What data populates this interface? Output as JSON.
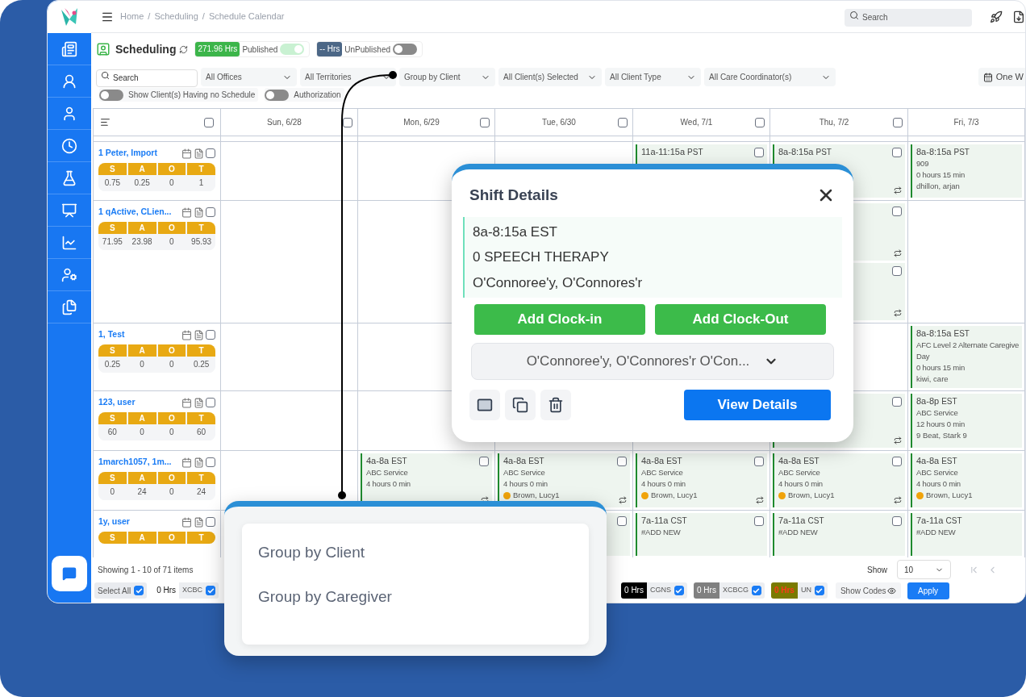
{
  "header": {
    "breadcrumbs": [
      "Home",
      "Scheduling",
      "Schedule Calendar"
    ],
    "separator": "/",
    "search": {
      "placeholder": "Search"
    }
  },
  "toolbar": {
    "title": "Scheduling",
    "published": {
      "hours": "271.96 Hrs",
      "label": "Published",
      "on": true
    },
    "unpublished": {
      "hours": "-- Hrs",
      "label": "UnPublished",
      "on": false
    }
  },
  "filters": {
    "search": {
      "placeholder": "Search"
    },
    "selects": [
      "All Offices",
      "All Territories",
      "Group by Client",
      "All Client(s) Selected",
      "All Client Type",
      "All Care Coordinator(s)"
    ],
    "range": "One W"
  },
  "toggles": [
    {
      "label": "Show Client(s) Having no Schedule",
      "on": false
    },
    {
      "label": "Authorization",
      "on": false
    }
  ],
  "grid": {
    "select_all_checked": false,
    "days": [
      {
        "label": "Sun, 6/28",
        "kind": "checkbox",
        "checked": false
      },
      {
        "label": "Mon, 6/29",
        "kind": "checkbox",
        "checked": false
      },
      {
        "label": "Tue, 6/30",
        "kind": "checkbox",
        "checked": false
      },
      {
        "label": "Wed, 7/1",
        "kind": "checkbox",
        "checked": false
      },
      {
        "label": "Thu, 7/2",
        "kind": "checkbox",
        "checked": false
      },
      {
        "label": "Fri, 7/3",
        "kind": "plain"
      }
    ]
  },
  "clients": [
    {
      "name": "1 Peter, Import",
      "checked": false,
      "stats": [
        {
          "label": "S",
          "value": "0.75"
        },
        {
          "label": "A",
          "value": "0.25"
        },
        {
          "label": "O",
          "value": "0"
        },
        {
          "label": "T",
          "value": "1"
        }
      ],
      "cells": [
        {},
        {},
        {},
        {
          "shifts": [
            {
              "time": "11a-11:15a",
              "zone": "PST",
              "checked": false
            }
          ]
        },
        {
          "shifts": [
            {
              "time": "8a-8:15a",
              "zone": "PST",
              "checked": false,
              "swap": true
            }
          ]
        },
        {
          "shifts": [
            {
              "time": "8a-8:15a",
              "zone": "PST",
              "lines": [
                "909",
                "0 hours 15 min"
              ],
              "caregiver": {
                "name": "dhillon, arjan",
                "warning": false
              }
            }
          ]
        }
      ]
    },
    {
      "name": "1 qActive, CLien...",
      "checked": false,
      "stats": [
        {
          "label": "S",
          "value": "71.95"
        },
        {
          "label": "A",
          "value": "23.98"
        },
        {
          "label": "O",
          "value": "0"
        },
        {
          "label": "T",
          "value": "95.93"
        }
      ],
      "cells": [
        {},
        {},
        {},
        {},
        {
          "shifts": [
            {
              "checked": false,
              "swap": true
            },
            {
              "checked": false,
              "swap": true
            }
          ]
        },
        {}
      ]
    },
    {
      "name": "1, Test",
      "checked": false,
      "stats": [
        {
          "label": "S",
          "value": "0.25"
        },
        {
          "label": "A",
          "value": "0"
        },
        {
          "label": "O",
          "value": "0"
        },
        {
          "label": "T",
          "value": "0.25"
        }
      ],
      "cells": [
        {},
        {},
        {},
        {},
        {},
        {
          "shifts": [
            {
              "time": "8a-8:15a",
              "zone": "EST",
              "lines": [
                "AFC Level 2 Alternate Caregive",
                "Day",
                "0 hours 15 min"
              ],
              "caregiver": {
                "name": "kiwi, care",
                "warning": false
              }
            }
          ]
        }
      ]
    },
    {
      "name": "123, user",
      "checked": false,
      "stats": [
        {
          "label": "S",
          "value": "60"
        },
        {
          "label": "A",
          "value": "0"
        },
        {
          "label": "O",
          "value": "0"
        },
        {
          "label": "T",
          "value": "60"
        }
      ],
      "cells": [
        {},
        {},
        {},
        {},
        {
          "shifts": [
            {
              "checked": false,
              "swap": true
            }
          ]
        },
        {
          "shifts": [
            {
              "time": "8a-8p",
              "zone": "EST",
              "lines": [
                "ABC Service",
                "12 hours 0 min"
              ],
              "caregiver": {
                "name": "9 Beat, Stark 9",
                "warning": false
              }
            }
          ]
        }
      ]
    },
    {
      "name": "1march1057, 1m...",
      "checked": false,
      "stats": [
        {
          "label": "S",
          "value": "0"
        },
        {
          "label": "A",
          "value": "24"
        },
        {
          "label": "O",
          "value": "0"
        },
        {
          "label": "T",
          "value": "24"
        }
      ],
      "cells": [
        {},
        {
          "shifts": [
            {
              "time": "4a-8a",
              "zone": "EST",
              "lines": [
                "ABC Service",
                "4 hours 0 min"
              ],
              "checked": false,
              "swap": true
            }
          ]
        },
        {
          "shifts": [
            {
              "time": "4a-8a",
              "zone": "EST",
              "lines": [
                "ABC Service",
                "4 hours 0 min"
              ],
              "caregiver": {
                "name": "Brown, Lucy1",
                "warning": true
              },
              "checked": false,
              "swap": true
            }
          ]
        },
        {
          "shifts": [
            {
              "time": "4a-8a",
              "zone": "EST",
              "lines": [
                "ABC Service",
                "4 hours 0 min"
              ],
              "caregiver": {
                "name": "Brown, Lucy1",
                "warning": true
              },
              "checked": false,
              "swap": true
            }
          ]
        },
        {
          "shifts": [
            {
              "time": "4a-8a",
              "zone": "EST",
              "lines": [
                "ABC Service",
                "4 hours 0 min"
              ],
              "caregiver": {
                "name": "Brown, Lucy1",
                "warning": true
              },
              "checked": false,
              "swap": true
            }
          ]
        },
        {
          "shifts": [
            {
              "time": "4a-8a",
              "zone": "EST",
              "lines": [
                "ABC Service",
                "4 hours 0 min"
              ],
              "caregiver": {
                "name": "Brown, Lucy1",
                "warning": true
              }
            }
          ]
        }
      ]
    },
    {
      "name": "1y, user",
      "checked": false,
      "stats": [
        {
          "label": "S"
        },
        {
          "label": "A"
        },
        {
          "label": "O"
        },
        {
          "label": "T"
        }
      ],
      "cells": [
        {},
        {},
        {
          "shifts": [
            {
              "checked": false
            }
          ]
        },
        {
          "shifts": [
            {
              "time": "7a-11a",
              "zone": "CST",
              "lines": [
                "#ADD NEW"
              ],
              "checked": false
            }
          ]
        },
        {
          "shifts": [
            {
              "time": "7a-11a",
              "zone": "CST",
              "lines": [
                "#ADD NEW"
              ],
              "checked": false
            }
          ]
        },
        {
          "shifts": [
            {
              "time": "7a-11a",
              "zone": "CST",
              "lines": [
                "#ADD NEW"
              ]
            }
          ]
        }
      ]
    }
  ],
  "footer": {
    "summary": "Showing 1 - 10 of 71 items",
    "page_size_label": "Show",
    "page_size": "10",
    "select_all": {
      "label": "Select All",
      "checked": true
    },
    "codes": [
      {
        "hours": "0 Hrs",
        "code": "XCBC",
        "checked": true,
        "color": "#ffffff",
        "alert": false
      },
      {
        "hours": "0 Hrs",
        "code": "CGNS",
        "checked": true,
        "color": "#000000",
        "alert": false
      },
      {
        "hours": "0 Hrs",
        "code": "XCBCG",
        "checked": true,
        "color": "#808080",
        "alert": false
      },
      {
        "hours": "0 Hrs",
        "code": "UN",
        "checked": true,
        "color": "#7a7a00",
        "alert": true
      }
    ],
    "show_codes": "Show Codes",
    "apply": "Apply"
  },
  "shift_popup": {
    "title": "Shift Details",
    "time": "8a-8:15a EST",
    "service": "0 SPEECH THERAPY",
    "client": "O'Connoree'y, O'Connores'r",
    "buttons": [
      "Add Clock-in",
      "Add Clock-Out"
    ],
    "caregiver": "O'Connoree'y, O'Connores'r O'Con...",
    "view": "View Details"
  },
  "group_menu": {
    "options": [
      "Group by Client",
      "Group by Caregiver"
    ]
  }
}
